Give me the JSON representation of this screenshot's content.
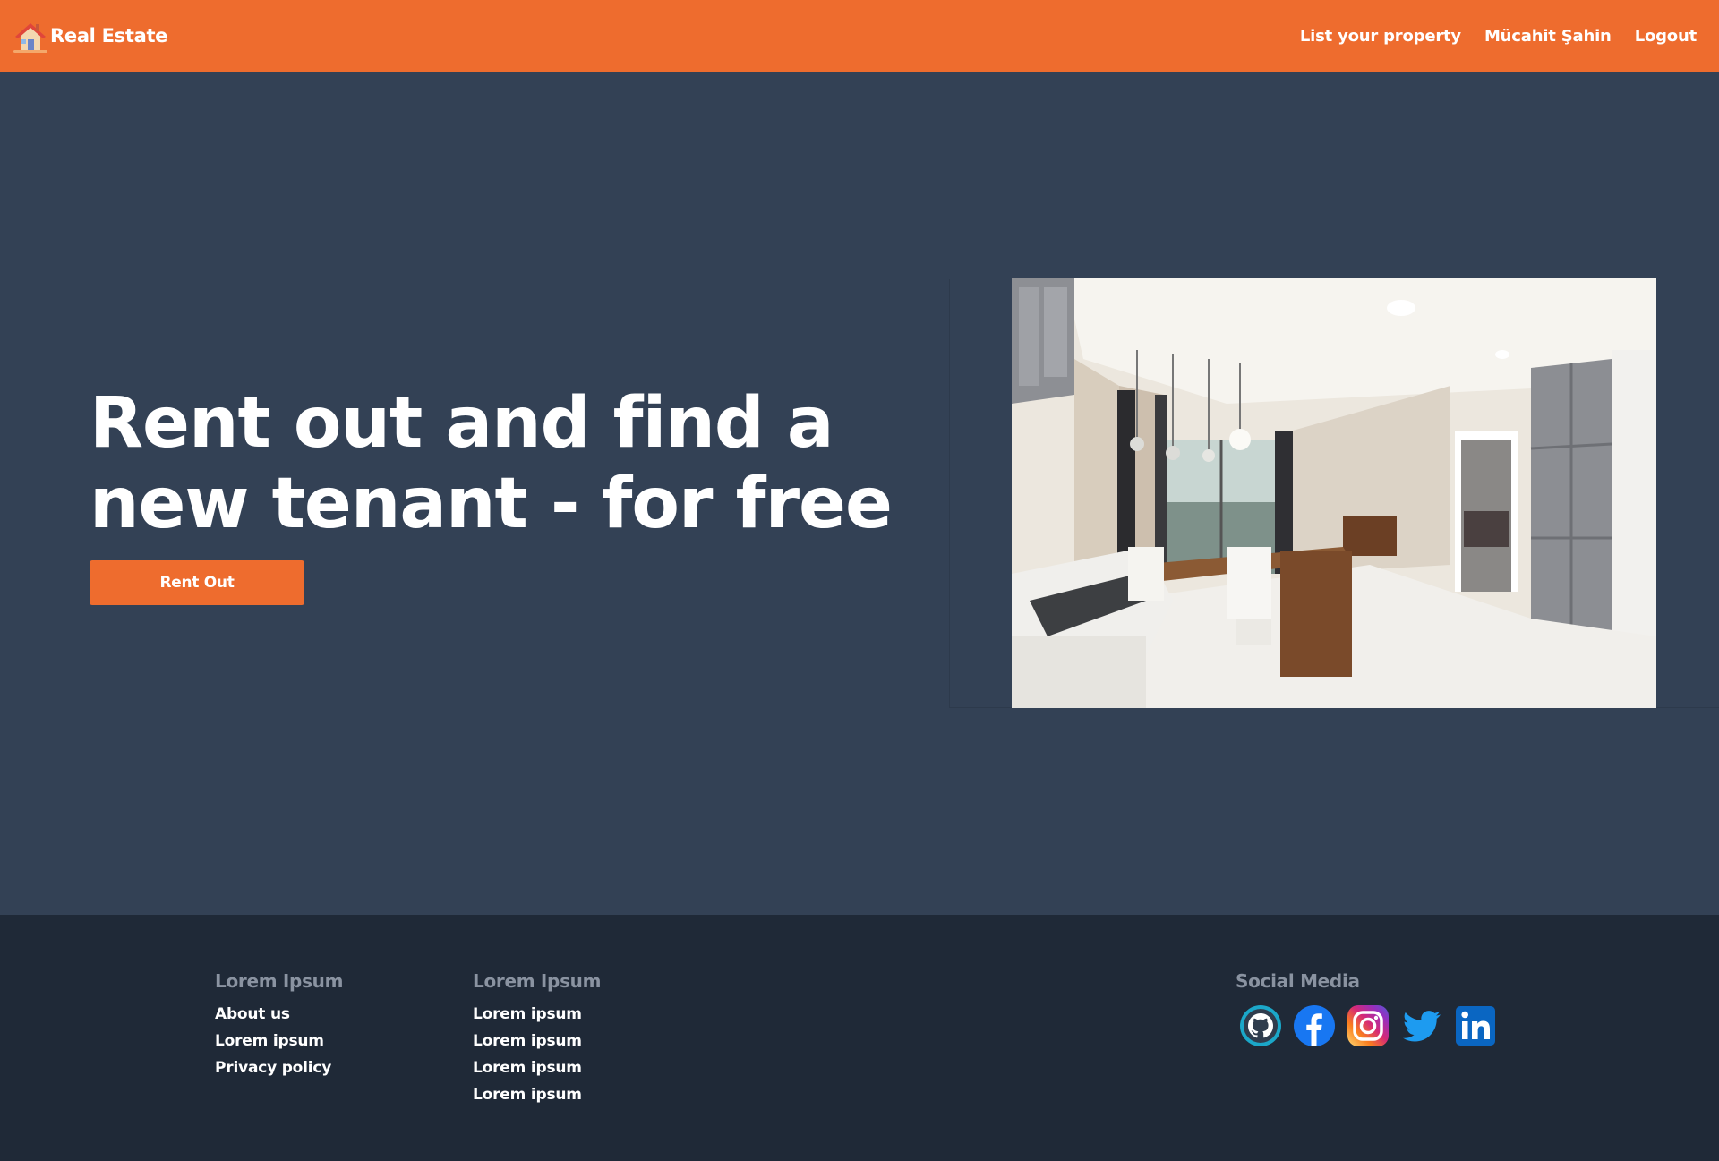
{
  "header": {
    "brand": "Real Estate",
    "nav": {
      "list_property": "List your property",
      "user": "Mücahit Şahin",
      "logout": "Logout"
    }
  },
  "hero": {
    "title_line1": "Rent out and find a",
    "title_line2": "new tenant - for free",
    "button": "Rent Out"
  },
  "footer": {
    "col1": {
      "heading": "Lorem Ipsum",
      "links": [
        "About us",
        "Lorem ipsum",
        "Privacy policy"
      ]
    },
    "col2": {
      "heading": "Lorem Ipsum",
      "links": [
        "Lorem ipsum",
        "Lorem ipsum",
        "Lorem ipsum",
        "Lorem ipsum"
      ]
    },
    "social": {
      "heading": "Social Media",
      "icons": [
        "github-icon",
        "facebook-icon",
        "instagram-icon",
        "twitter-icon",
        "linkedin-icon"
      ]
    }
  },
  "colors": {
    "accent": "#ee6c2e",
    "hero_bg": "#334155",
    "footer_bg": "#1f2937",
    "footer_heading": "#8a93a1"
  }
}
